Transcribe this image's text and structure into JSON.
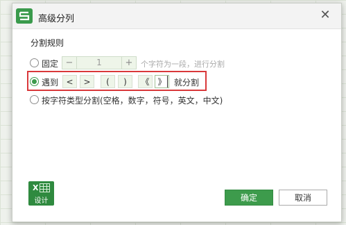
{
  "dialog": {
    "title": "高级分列",
    "close_label": "✕"
  },
  "rules": {
    "section_label": "分割规则",
    "fixed": {
      "label": "固定",
      "value": "1",
      "minus": "−",
      "plus": "+",
      "hint": "个字符为一段，进行分割",
      "selected": false
    },
    "delimiter": {
      "label": "遇到",
      "symbols": [
        "<",
        ">",
        "(",
        ")",
        "《",
        "》"
      ],
      "suffix": "就分割",
      "selected": true
    },
    "by_type": {
      "label": "按字符类型分割(空格，数字，符号，英文，中文)",
      "selected": false
    }
  },
  "footer": {
    "icon_label": "设计",
    "ok_label": "确定",
    "cancel_label": "取消"
  },
  "colors": {
    "accent": "#3d9b4c",
    "highlight_border": "#d9383a"
  }
}
